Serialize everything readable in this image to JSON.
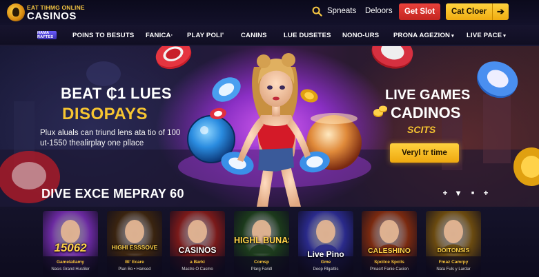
{
  "header": {
    "logo_top": "EAT TIHMG ONLINE",
    "logo_main": "CASINOS",
    "links": [
      "Spneats",
      "Deloors"
    ],
    "btn_red": "Get Slot",
    "btn_yellow": "Cat Cloer",
    "btn_yellow_icon": "arrow-right-icon"
  },
  "nav": {
    "badge": "HAMA RAFTES",
    "items": [
      {
        "label": "POINS TO BESUTS",
        "caret": false
      },
      {
        "label": "FANICA·",
        "caret": false
      },
      {
        "label": "PLAY POLI'",
        "caret": false
      },
      {
        "label": "CANINS",
        "caret": false
      },
      {
        "label": "LUE DUSETES",
        "caret": false
      },
      {
        "label": "NONO-URS",
        "caret": false
      },
      {
        "label": "PRONA AGEZION",
        "caret": true
      },
      {
        "label": "LIVE PACE",
        "caret": true
      }
    ]
  },
  "hero": {
    "left_line1": "BEAT ₵1 LUES",
    "left_line2": "DISOPAYS",
    "left_sub": "Plux aluals can triund lens ata tio of 100 ut-1550 thealirplay one pllace",
    "right_line1": "LIVE GAMES",
    "right_line2": "CADINOS",
    "right_line3": "SCITS",
    "cta": "Veryl tr time",
    "colors": {
      "accent_gold": "#f7c531",
      "accent_purple": "#c04ee6"
    }
  },
  "games": {
    "title": "DIVE EXCE MEPRAY 60",
    "controls": [
      "+",
      "▾",
      "■",
      "+"
    ],
    "tiles": [
      {
        "title": "15062",
        "sub": "Gamelallamy",
        "sub2": "Nasis Grand Hustiler",
        "color": "#6b2aa0"
      },
      {
        "title": "HIGHI ESSSOVE",
        "sub": "Bl' Ecare",
        "sub2": "Plan Bo • Hansed",
        "color": "#3a2410"
      },
      {
        "title": "CASINOS",
        "sub": "a Barki",
        "sub2": "Mastre O Casmo",
        "color": "#7a1a1a"
      },
      {
        "title": "HIGHL BUNAS",
        "sub": "Comsp",
        "sub2": "Plarg Faridl",
        "color": "#1c3a1c"
      },
      {
        "title": "Live Pino",
        "sub": "Gme",
        "sub2": "Deop Rlgaltlis",
        "color": "#2a2a8a"
      },
      {
        "title": "CALESHINO",
        "sub": "Spcilce Spcils",
        "sub2": "Pmasrt Fanie Cacion",
        "color": "#7a2a10"
      },
      {
        "title": "DOITONSIS",
        "sub": "Fmaz Camrpy",
        "sub2": "Nata Fuls y Lardar",
        "color": "#6a4a10"
      }
    ]
  }
}
